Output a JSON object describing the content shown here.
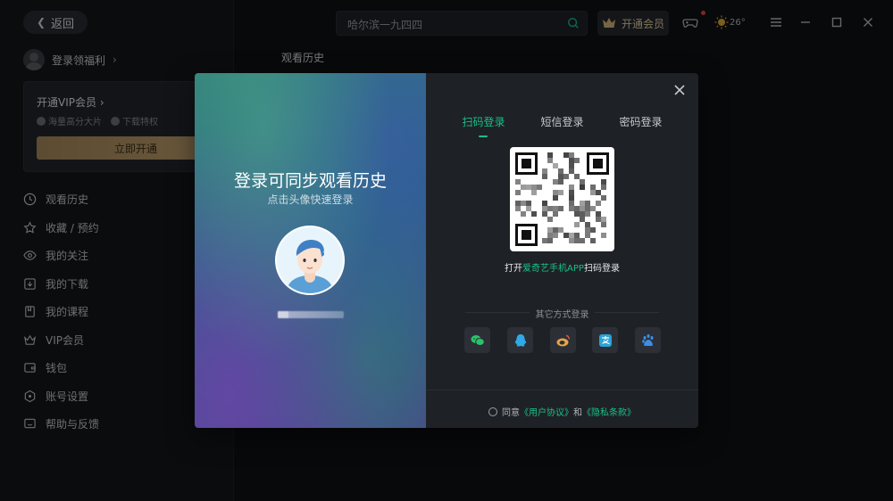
{
  "header": {
    "back_label": "返回",
    "search_value": "哈尔滨一九四四",
    "vip_label": "开通会员",
    "weather_temp": "26°"
  },
  "sidebar": {
    "login_label": "登录领福利",
    "vip_card_title": "开通VIP会员",
    "benefit_1": "海量高分大片",
    "benefit_2": "下载特权",
    "open_button": "立即开通",
    "items": [
      {
        "label": "观看历史",
        "icon": "clock-icon"
      },
      {
        "label": "收藏 / 预约",
        "icon": "star-icon"
      },
      {
        "label": "我的关注",
        "icon": "eye-icon"
      },
      {
        "label": "我的下载",
        "icon": "download-icon"
      },
      {
        "label": "我的课程",
        "icon": "book-icon"
      },
      {
        "label": "VIP会员",
        "icon": "crown-icon"
      },
      {
        "label": "钱包",
        "icon": "wallet-icon"
      },
      {
        "label": "账号设置",
        "icon": "settings-icon"
      },
      {
        "label": "帮助与反馈",
        "icon": "feedback-icon"
      }
    ]
  },
  "main": {
    "title": "观看历史"
  },
  "login_modal": {
    "left_title": "登录可同步观看历史",
    "left_subtitle": "点击头像快速登录",
    "tabs": [
      "扫码登录",
      "短信登录",
      "密码登录"
    ],
    "qr_hint_pre": "打开",
    "qr_hint_app": "爱奇艺手机APP",
    "qr_hint_post": "扫码登录",
    "other_methods": "其它方式登录",
    "agree_pre": "同意",
    "agree_user": "《用户协议》",
    "agree_and": "和",
    "agree_privacy": "《隐私条款》"
  },
  "colors": {
    "accent": "#19c086",
    "vip_gold": "#c6a572",
    "background": "#0f1114"
  }
}
